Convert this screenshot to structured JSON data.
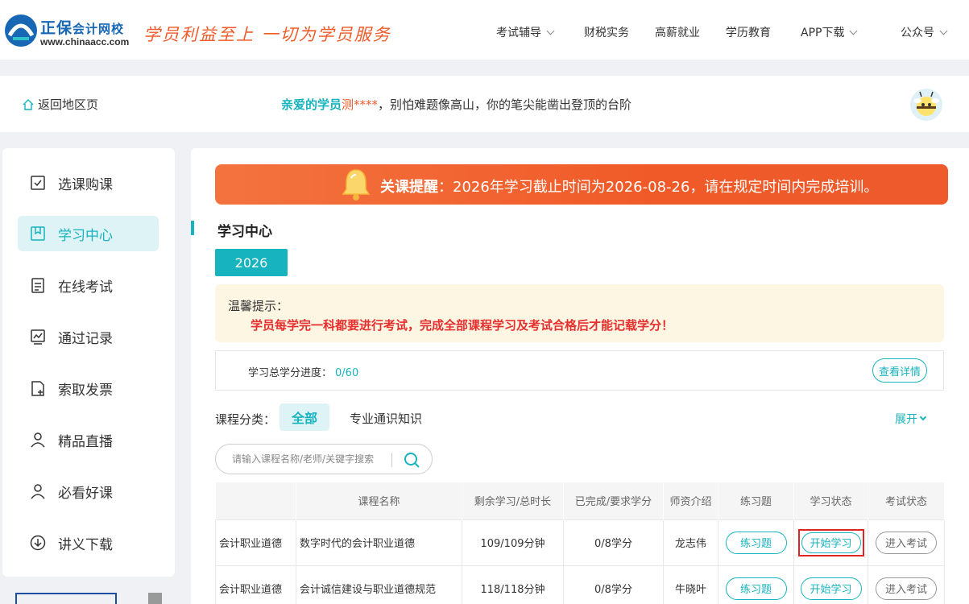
{
  "header": {
    "logo_main": "正保",
    "logo_sub": "会计网校",
    "logo_url": "www.chinaacc.com",
    "slogan": "学员利益至上  一切为学员服务",
    "nav": [
      {
        "label": "考试辅导",
        "has_dropdown": true
      },
      {
        "label": "财税实务",
        "has_dropdown": false
      },
      {
        "label": "高薪就业",
        "has_dropdown": false
      },
      {
        "label": "学历教育",
        "has_dropdown": false
      },
      {
        "label": "APP下载",
        "has_dropdown": true
      },
      {
        "label": "公众号",
        "has_dropdown": true
      }
    ]
  },
  "greeting": {
    "back_label": "返回地区页",
    "prefix": "亲爱的学员",
    "name": "测****",
    "message": "，别怕难题像高山，你的笔尖能凿出登顶的台阶"
  },
  "sidebar": {
    "items": [
      {
        "label": "选课购课",
        "icon": "checklist-icon"
      },
      {
        "label": "学习中心",
        "icon": "bookmark-icon",
        "active": true
      },
      {
        "label": "在线考试",
        "icon": "document-icon"
      },
      {
        "label": "通过记录",
        "icon": "chart-icon"
      },
      {
        "label": "索取发票",
        "icon": "invoice-icon"
      },
      {
        "label": "精品直播",
        "icon": "user-icon"
      },
      {
        "label": "必看好课",
        "icon": "user-icon"
      },
      {
        "label": "讲义下载",
        "icon": "download-icon"
      }
    ]
  },
  "main": {
    "banner_title": "关课提醒",
    "banner_text": "：2026年学习截止时间为2026-08-26，请在规定时间内完成培训。",
    "section_title": "学习中心",
    "year_tab": "2026",
    "tip_head": "温馨提示：",
    "tip_body": "学员每学完一科都要进行考试，完成全部课程学习及考试合格后才能记载学分！",
    "progress_label": "学习总学分进度：",
    "progress_value": "0/60",
    "detail_button": "查看详情",
    "category_label": "课程分类：",
    "category_all": "全部",
    "category_general": "专业通识知识",
    "expand_label": "展开",
    "search_placeholder": "请输入课程名称/老师/关键字搜索"
  },
  "table": {
    "headers": [
      "",
      "课程名称",
      "剩余学习/总时长",
      "已完成/要求学分",
      "师资介绍",
      "练习题",
      "学习状态",
      "考试状态"
    ],
    "rows": [
      {
        "category": "会计职业道德",
        "name": "数字时代的会计职业道德",
        "time": "109/109分钟",
        "credits": "0/8学分",
        "teacher": "龙志伟",
        "practice": "练习题",
        "study": "开始学习",
        "exam": "进入考试"
      },
      {
        "category": "会计职业道德",
        "name": "会计诚信建设与职业道德规范",
        "time": "118/118分钟",
        "credits": "0/8学分",
        "teacher": "牛晓叶",
        "practice": "练习题",
        "study": "开始学习",
        "exam": "进入考试"
      }
    ]
  },
  "colors": {
    "accent": "#17b3be",
    "orange": "#f05a28",
    "brand_blue": "#1767b5",
    "warning_red": "#e62f2f"
  }
}
